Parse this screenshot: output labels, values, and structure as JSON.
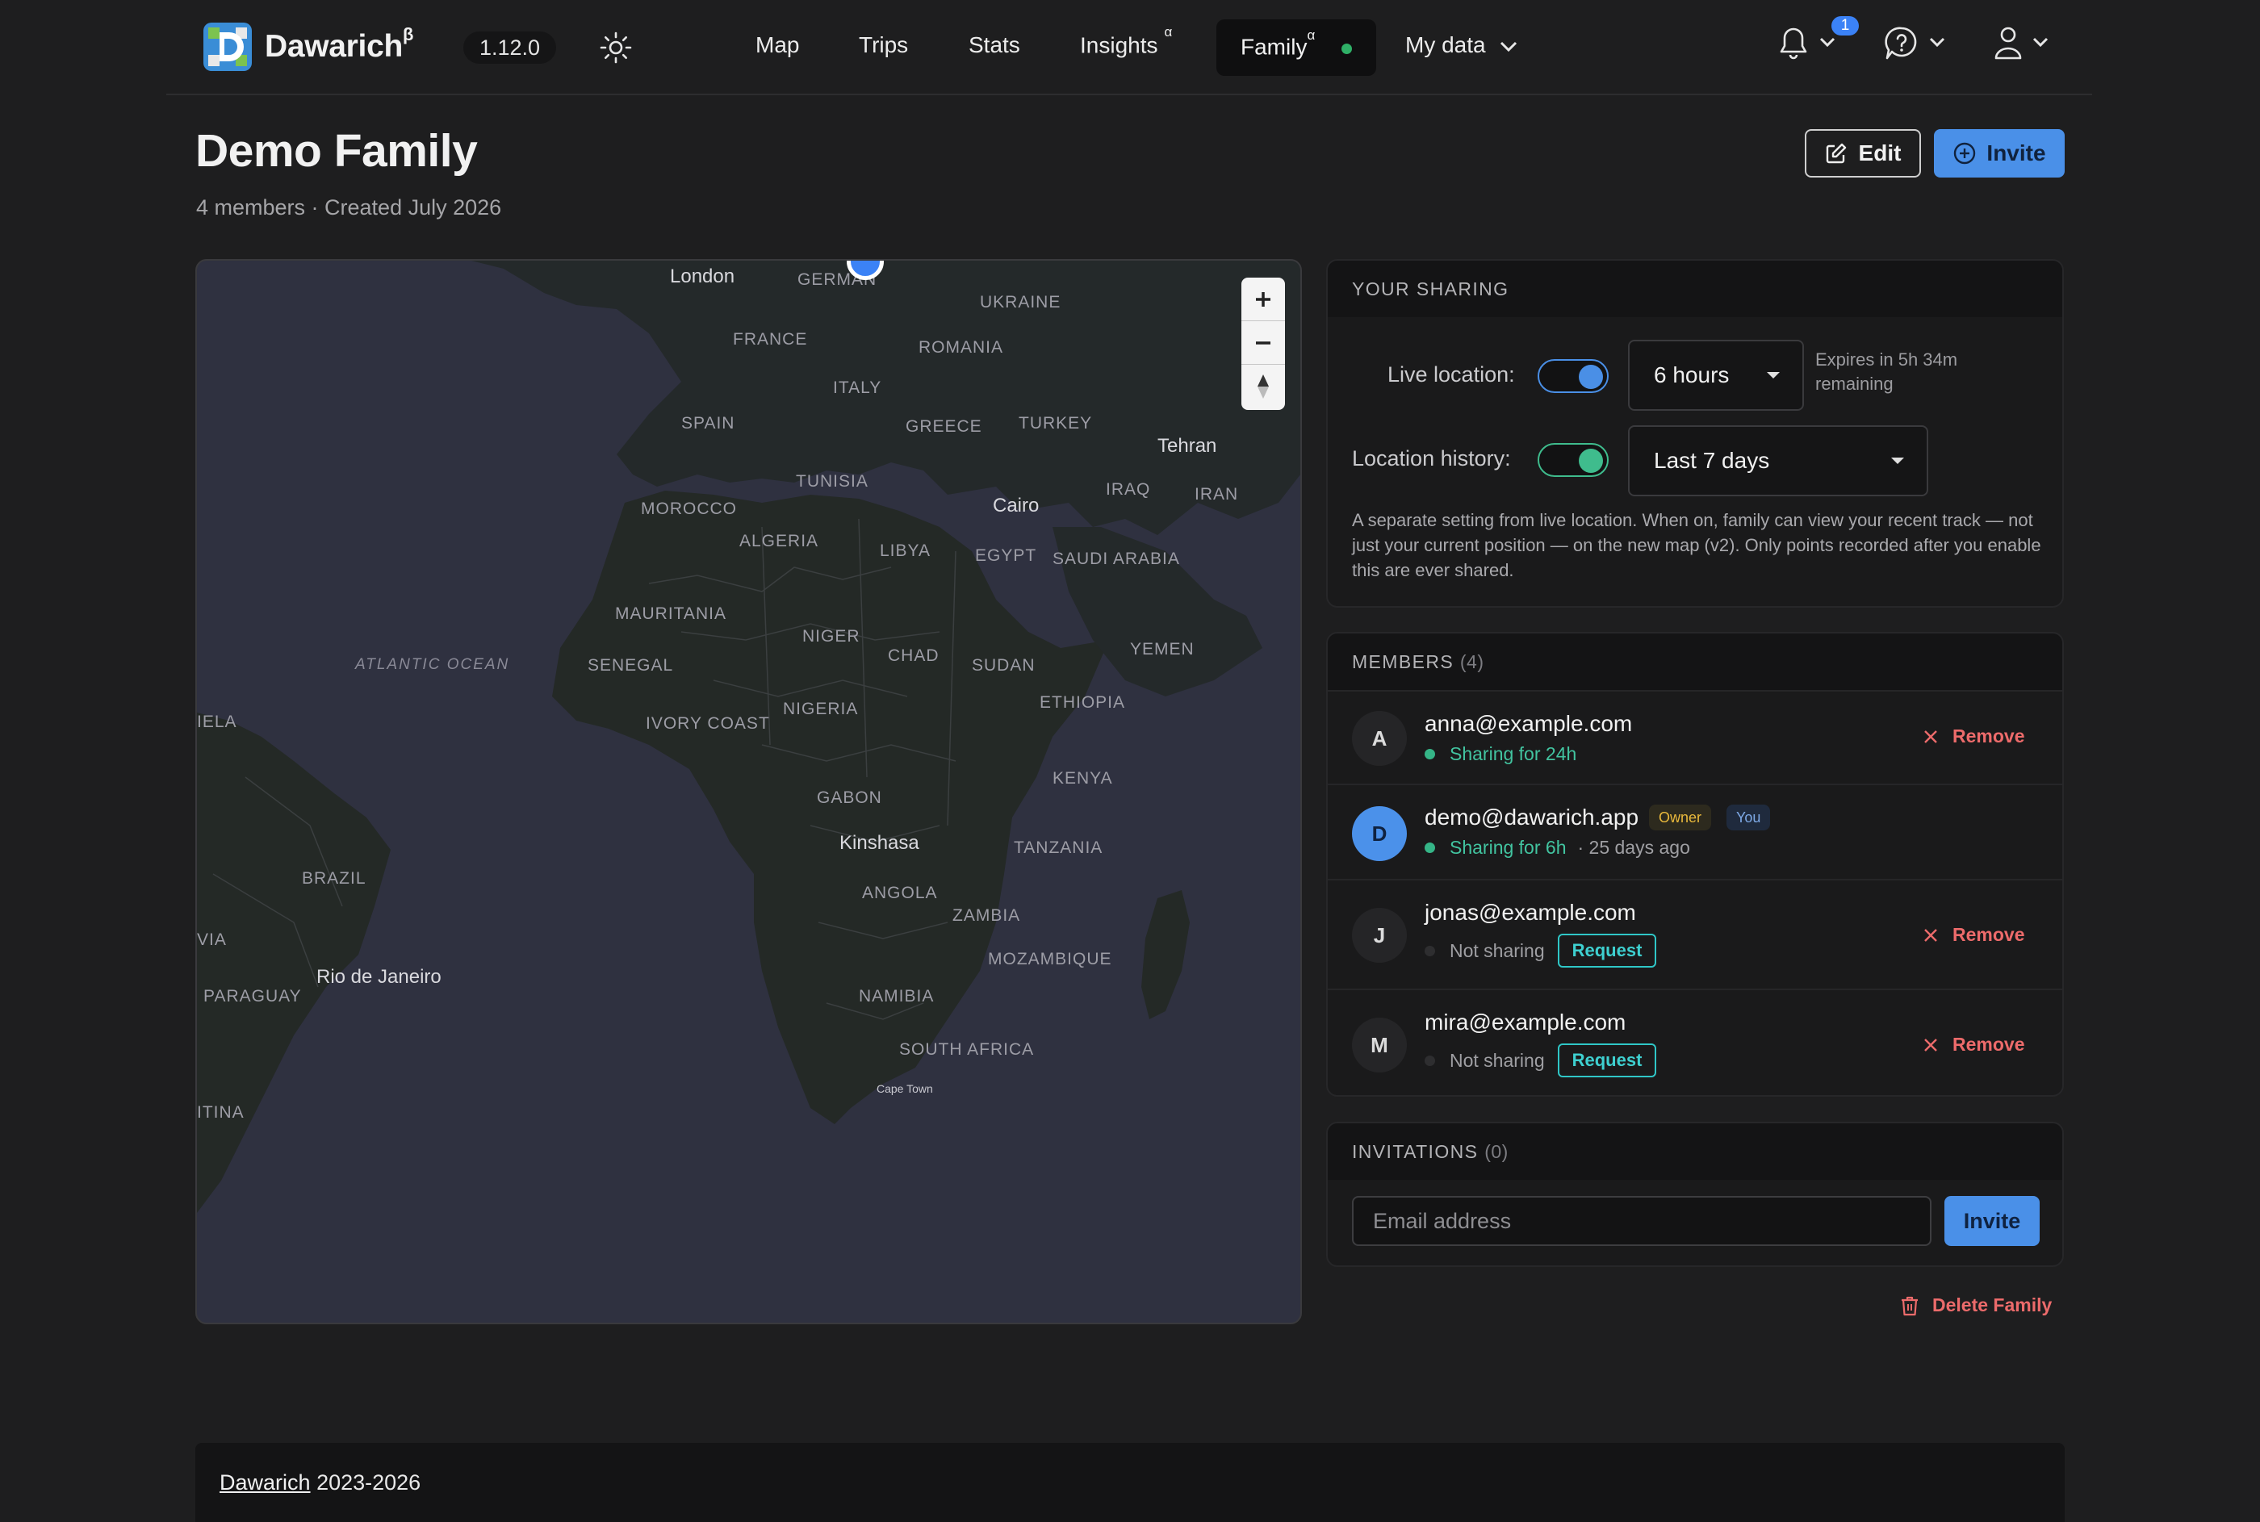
{
  "app": {
    "brand": "Dawarich",
    "brand_sup": "β",
    "version": "1.12.0",
    "notification_count": "1"
  },
  "nav": {
    "map": "Map",
    "trips": "Trips",
    "stats": "Stats",
    "insights": "Insights",
    "insights_sup": "α",
    "family": "Family",
    "family_sup": "α",
    "my_data": "My data"
  },
  "header": {
    "title": "Demo Family",
    "subtitle": "4 members · Created July 2026",
    "edit_label": "Edit",
    "invite_label": "Invite"
  },
  "map": {
    "labels": {
      "london": "London",
      "germany": "GERMAN",
      "ukraine": "UKRAINE",
      "france": "FRANCE",
      "romania": "ROMANIA",
      "italy": "ITALY",
      "spain": "SPAIN",
      "greece": "GREECE",
      "turkey": "TURKEY",
      "tehran": "Tehran",
      "tunisia": "TUNISIA",
      "iraq": "IRAQ",
      "iran": "IRAN",
      "morocco": "MOROCCO",
      "cairo": "Cairo",
      "algeria": "ALGERIA",
      "libya": "LIBYA",
      "egypt": "EGYPT",
      "saudi": "SAUDI ARABIA",
      "mauritania": "MAURITANIA",
      "niger": "NIGER",
      "chad": "CHAD",
      "sudan": "SUDAN",
      "yemen": "YEMEN",
      "atlantic": "ATLANTIC OCEAN",
      "senegal": "SENEGAL",
      "ela": "IELA",
      "nigeria": "NIGERIA",
      "ethiopia": "ETHIOPIA",
      "ivory": "IVORY COAST",
      "gabon": "GABON",
      "kenya": "KENYA",
      "kinshasa": "Kinshasa",
      "tanzania": "TANZANIA",
      "angola": "ANGOLA",
      "brazil": "BRAZIL",
      "zambia": "ZAMBIA",
      "via": "VIA",
      "mozambique": "MOZAMBIQUE",
      "rio": "Rio de Janeiro",
      "paraguay": "PARAGUAY",
      "namibia": "NAMIBIA",
      "south_africa": "SOUTH AFRICA",
      "itina": "ITINA",
      "cape_town": "Cape Town"
    }
  },
  "sharing": {
    "heading": "YOUR SHARING",
    "live_label": "Live location:",
    "live_enabled": true,
    "live_duration": "6 hours",
    "expires": "Expires in 5h 34m remaining",
    "history_label": "Location history:",
    "history_enabled": true,
    "history_range": "Last 7 days",
    "note": "A separate setting from live location. When on, family can view your recent track — not just your current position — on the new map (v2). Only points recorded after you enable this are ever shared."
  },
  "members": {
    "heading": "MEMBERS",
    "count": "(4)",
    "remove_label": "Remove",
    "request_label": "Request",
    "items": [
      {
        "initial": "A",
        "email": "anna@example.com",
        "status": "Sharing for 24h"
      },
      {
        "initial": "D",
        "email": "demo@dawarich.app",
        "badge_owner": "Owner",
        "badge_you": "You",
        "status": "Sharing for 6h",
        "last_seen": "· 25 days ago"
      },
      {
        "initial": "J",
        "email": "jonas@example.com",
        "status": "Not sharing"
      },
      {
        "initial": "M",
        "email": "mira@example.com",
        "status": "Not sharing"
      }
    ]
  },
  "invitations": {
    "heading": "INVITATIONS",
    "count": "(0)",
    "email_placeholder": "Email address",
    "invite_label": "Invite"
  },
  "delete_family_label": "Delete Family",
  "footer": {
    "link": "Dawarich",
    "years": "2023-2026"
  },
  "colors": {
    "accent": "#4a90e8",
    "success": "#35b587",
    "danger": "#ec6b6b",
    "request": "#2fc7c7"
  }
}
